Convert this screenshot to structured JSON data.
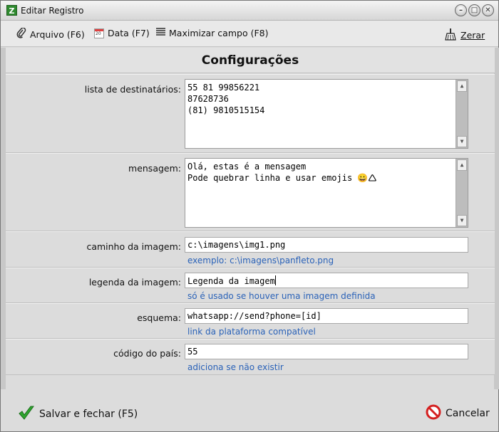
{
  "window": {
    "app_icon_letter": "Z",
    "title": "Editar Registro",
    "minimize_glyph": "–",
    "maximize_glyph": "□",
    "close_glyph": "✕"
  },
  "toolbar": {
    "arquivo_label": "Arquivo (F6)",
    "data_label": "Data (F7)",
    "data_icon_text": "20",
    "maximizar_label": "Maximizar campo (F8)",
    "zerar_label": "Zerar"
  },
  "header": {
    "title": "Configurações"
  },
  "fields": {
    "destinatarios": {
      "label": "lista de destinatários:",
      "lines": [
        "55 81 99856221",
        "87628736",
        "(81) 9810515154"
      ]
    },
    "mensagem": {
      "label": "mensagem:",
      "lines": [
        "Olá, estas é a mensagem",
        "Pode quebrar linha e usar emojis 😀🛆"
      ]
    },
    "caminho": {
      "label": "caminho da imagem:",
      "value": "c:\\imagens\\img1.png",
      "hint": "exemplo: c:\\imagens\\panfleto.png"
    },
    "legenda": {
      "label": "legenda da imagem:",
      "value": "Legenda da imagem",
      "hint": "só é usado se houver uma imagem definida"
    },
    "esquema": {
      "label": "esquema:",
      "value": "whatsapp://send?phone=[id]",
      "hint": "link da plataforma compatível"
    },
    "codigo": {
      "label": "código do país:",
      "value": "55",
      "hint": "adiciona se não existir"
    }
  },
  "footer": {
    "save_label": "Salvar e fechar (F5)",
    "cancel_label": "Cancelar"
  },
  "colors": {
    "hint": "#2a62b8",
    "save_check": "#2fa52f",
    "cancel_icon": "#d42020"
  }
}
